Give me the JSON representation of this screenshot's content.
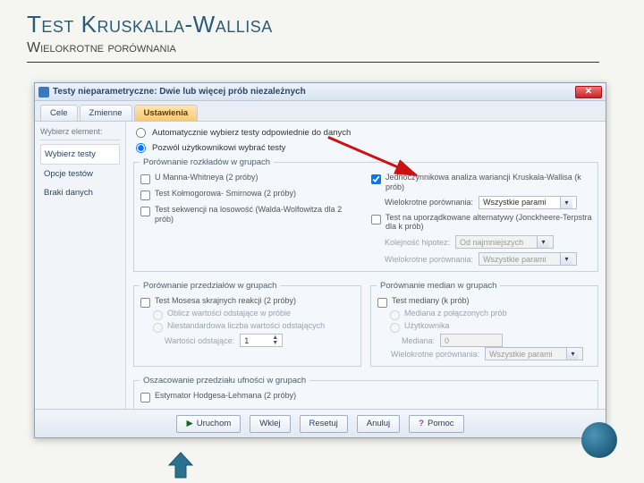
{
  "slide": {
    "title": "Test Kruskalla-Wallisa",
    "subtitle": "Wielokrotne porównania"
  },
  "window": {
    "title": "Testy nieparametryczne: Dwie lub więcej prób niezależnych"
  },
  "tabs": {
    "t0": "Cele",
    "t1": "Zmienne",
    "t2": "Ustawienia"
  },
  "sidebar": {
    "head": "Wybierz element:",
    "i0": "Wybierz testy",
    "i1": "Opcje testów",
    "i2": "Braki danych"
  },
  "opts": {
    "auto": "Automatycznie wybierz testy odpowiednie do danych",
    "manual": "Pozwól użytkownikowi wybrać testy"
  },
  "fs1": {
    "legend": "Porównanie rozkładów w grupach",
    "mann": "U Manna-Whitneya (2 próby)",
    "ks": "Test Kołmogorowa- Smirnowa (2 próby)",
    "seq": "Test sekwencji na losowość (Walda-Wolfowitza dla 2 prób)",
    "kw": "Jednoczynnikowa analiza wariancji Kruskala-Wallisa (k prób)",
    "mc_lbl": "Wielokrotne porównania:",
    "mc_val": "Wszystkie parami",
    "jt": "Test na uporządkowane alternatywy (Jonckheere-Terpstra dla k prób)",
    "hyp_lbl": "Kolejność hipotez:",
    "hyp_val": "Od najmniejszych",
    "mc2_lbl": "Wielokrotne porównania:",
    "mc2_val": "Wszystkie parami"
  },
  "fs2": {
    "legend": "Porównanie przedziałów w grupach",
    "moses": "Test Mosesa skrajnych reakcji (2 próby)",
    "r1": "Oblicz wartości odstające w próbie",
    "r2": "Niestandardowa liczba wartości odstających",
    "out_lbl": "Wartości odstające:",
    "out_val": "1"
  },
  "fs3": {
    "legend": "Porównanie median w grupach",
    "med": "Test mediany (k prób)",
    "r1": "Mediana z połączonych prób",
    "r2": "Użytkownika",
    "med_lbl": "Mediana:",
    "med_val": "0",
    "mc_lbl": "Wielokrotne porównania:",
    "mc_val": "Wszystkie parami"
  },
  "fs4": {
    "legend": "Oszacowanie przedziału ufności w grupach",
    "hl": "Estymator Hodgesa-Lehmana (2 próby)"
  },
  "buttons": {
    "run": "Uruchom",
    "paste": "Wklej",
    "reset": "Resetuj",
    "cancel": "Anuluj",
    "help": "Pomoc"
  }
}
